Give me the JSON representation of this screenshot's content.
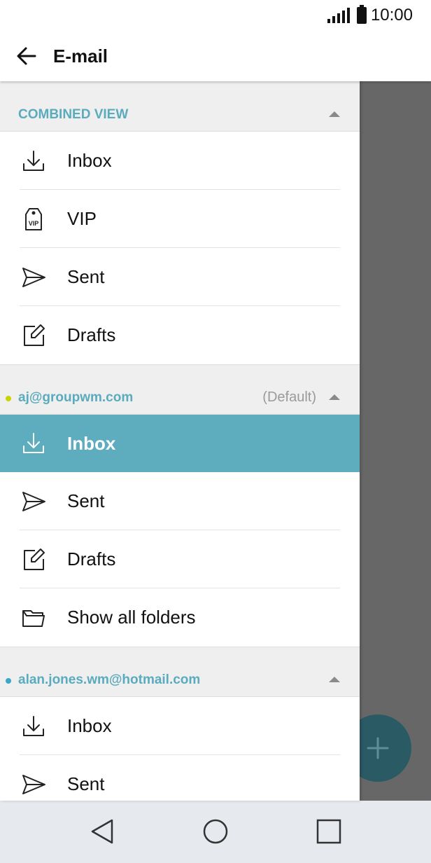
{
  "status_bar": {
    "time": "10:00"
  },
  "app_bar": {
    "title": "E-mail"
  },
  "sections": [
    {
      "title": "COMBINED VIEW",
      "items": [
        {
          "label": "Inbox",
          "icon": "inbox-icon"
        },
        {
          "label": "VIP",
          "icon": "vip-tag-icon"
        },
        {
          "label": "Sent",
          "icon": "send-icon"
        },
        {
          "label": "Drafts",
          "icon": "edit-icon"
        }
      ]
    },
    {
      "title": "aj@groupwm.com",
      "badge": "(Default)",
      "dot_color": "#c8d400",
      "items": [
        {
          "label": "Inbox",
          "icon": "inbox-icon",
          "selected": true
        },
        {
          "label": "Sent",
          "icon": "send-icon"
        },
        {
          "label": "Drafts",
          "icon": "edit-icon"
        },
        {
          "label": "Show all folders",
          "icon": "folder-icon"
        }
      ]
    },
    {
      "title": "alan.jones.wm@hotmail.com",
      "dot_color": "#3aa6c9",
      "items": [
        {
          "label": "Inbox",
          "icon": "inbox-icon"
        },
        {
          "label": "Sent",
          "icon": "send-icon"
        }
      ]
    }
  ],
  "colors": {
    "accent": "#5dadbe",
    "header_text": "#5aabbd",
    "fab": "#2a5a63"
  }
}
